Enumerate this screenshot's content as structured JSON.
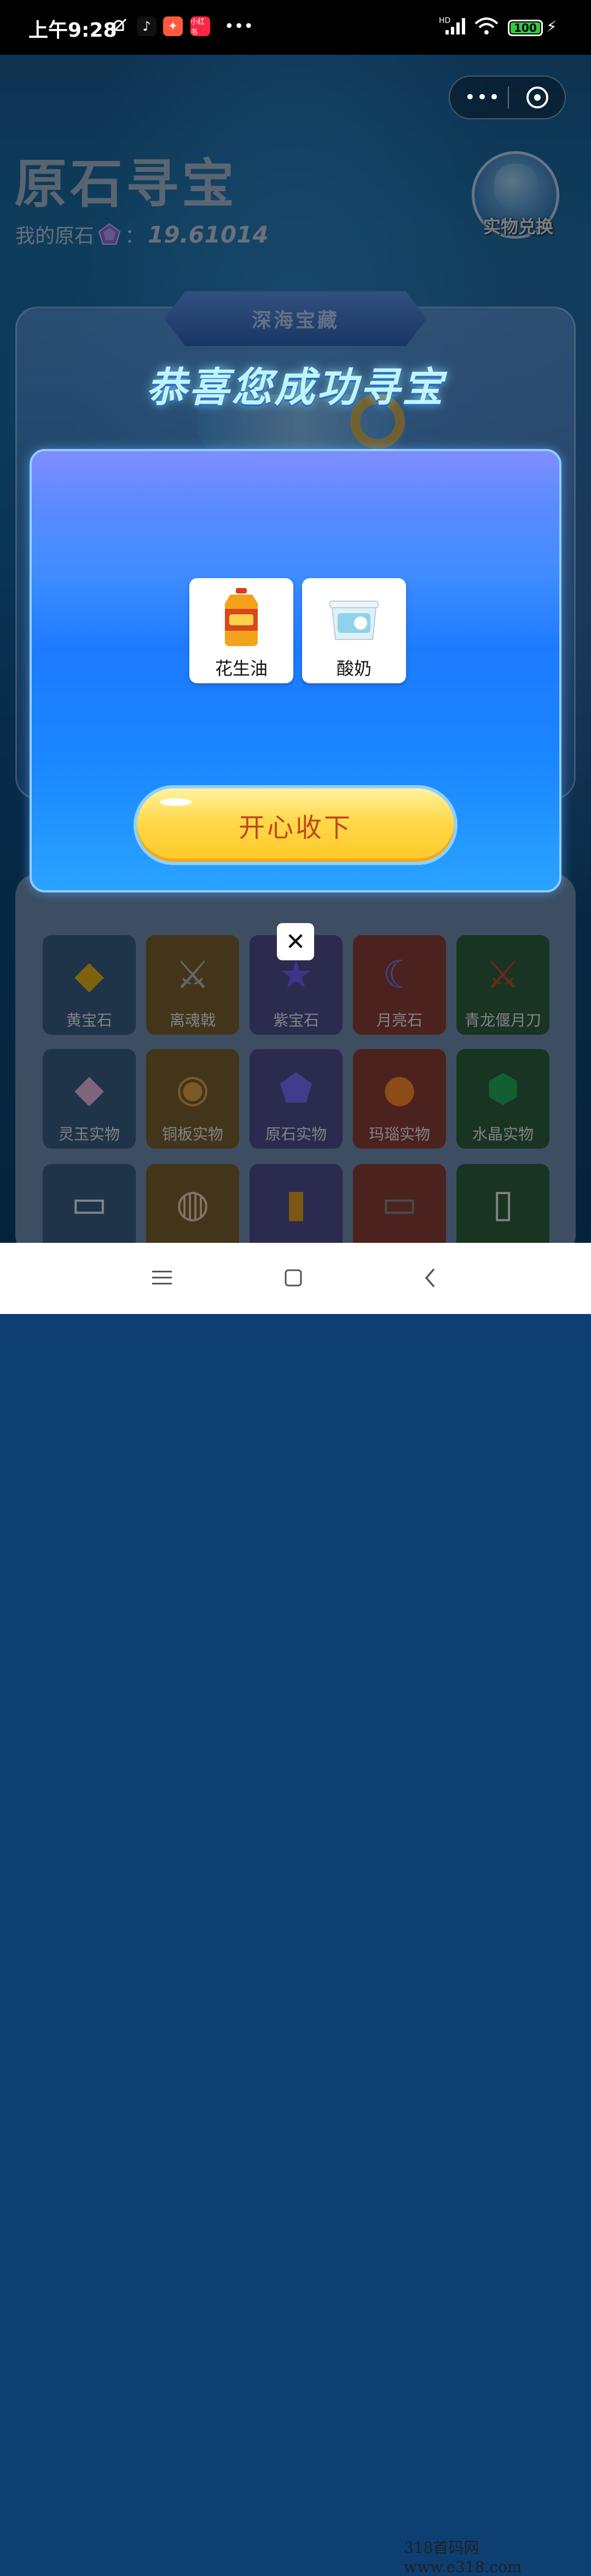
{
  "status_bar": {
    "time": "上午9:28",
    "app_badges": [
      "小红书"
    ],
    "network": "HD",
    "battery": "100"
  },
  "header": {
    "title": "原石寻宝",
    "my_stone_label": "我的原石",
    "my_stone_value": "19.61014",
    "exchange_label": "实物兑换"
  },
  "panel": {
    "ribbon": "深海宝藏",
    "headline": "恭喜您成功寻宝"
  },
  "modal": {
    "prizes": [
      {
        "label": "花生油",
        "icon": "peanut-oil-bottle"
      },
      {
        "label": "酸奶",
        "icon": "yogurt-tub"
      }
    ],
    "collect_button": "开心收下",
    "close_symbol": "✕"
  },
  "grid": {
    "rows": [
      [
        {
          "label": "黄宝石",
          "color": "#3b5f86"
        },
        {
          "label": "离魂戟",
          "color": "#7a6130"
        },
        {
          "label": "紫宝石",
          "color": "#4e4f8f"
        },
        {
          "label": "月亮石",
          "color": "#8a3f3a"
        },
        {
          "label": "青龙偃月刀",
          "color": "#2f5f3e"
        }
      ],
      [
        {
          "label": "灵玉实物",
          "color": "#3b5f86"
        },
        {
          "label": "铜板实物",
          "color": "#7a6130"
        },
        {
          "label": "原石实物",
          "color": "#4e4f8f"
        },
        {
          "label": "玛瑙实物",
          "color": "#8a3f3a"
        },
        {
          "label": "水晶实物",
          "color": "#2f5f3e"
        }
      ],
      [
        {
          "label": "",
          "color": "#3b5f86"
        },
        {
          "label": "",
          "color": "#7a6130"
        },
        {
          "label": "",
          "color": "#4e4f8f"
        },
        {
          "label": "",
          "color": "#8a3f3a"
        },
        {
          "label": "",
          "color": "#2f5f3e"
        }
      ]
    ]
  },
  "watermark": "318首码网  www.e318.com"
}
